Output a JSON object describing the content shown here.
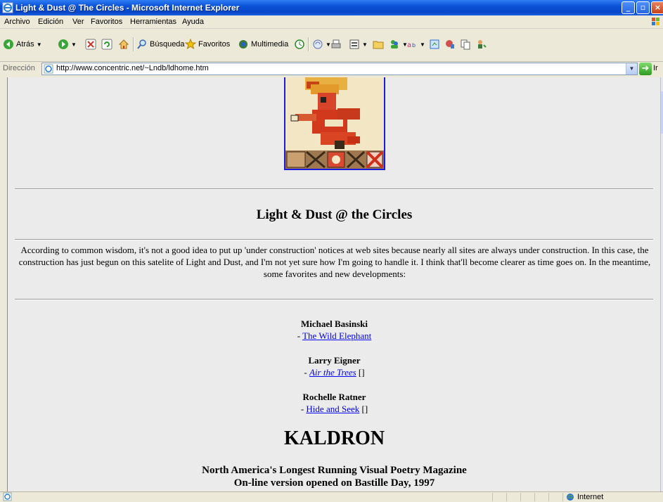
{
  "window": {
    "title": "Light & Dust @ The Circles - Microsoft Internet Explorer"
  },
  "menu": [
    "Archivo",
    "Edición",
    "Ver",
    "Favoritos",
    "Herramientas",
    "Ayuda"
  ],
  "toolbar": {
    "back": "Atrás",
    "search": "Búsqueda",
    "favorites": "Favoritos",
    "media": "Multimedia"
  },
  "address": {
    "label": "Dirección",
    "url": "http://www.concentric.net/~Lndb/ldhome.htm",
    "go": "Ir"
  },
  "page": {
    "heading": "Light & Dust @ the Circles",
    "intro": "According to common wisdom, it's not a good idea to put up 'under construction' notices at web sites because nearly all sites are always under construction. In this case, the construction has just begun on this satelite of Light and Dust, and I'm not yet sure how I'm going to handle it. I think that'll become clearer as time goes on. In the meantime, some favorites and new developments:",
    "entries": [
      {
        "author": "Michael Basinski",
        "prefix": "- ",
        "link": "The Wild Elephant",
        "suffix": ""
      },
      {
        "author": "Larry Eigner",
        "prefix": "- ",
        "link": "Air the Trees",
        "suffix": " []"
      },
      {
        "author": "Rochelle Ratner",
        "prefix": "- ",
        "link": "Hide and Seek",
        "suffix": " []"
      }
    ],
    "kaldron": "KALDRON",
    "kaldron_sub1": "North America's Longest Running Visual Poetry Magazine",
    "kaldron_sub2": "On-line version opened on Bastille Day, 1997"
  },
  "status": {
    "zone": "Internet"
  },
  "colors": {
    "link": "#0000ee",
    "titlebar": "#0a52d6",
    "content_bg": "#ebebeb"
  }
}
